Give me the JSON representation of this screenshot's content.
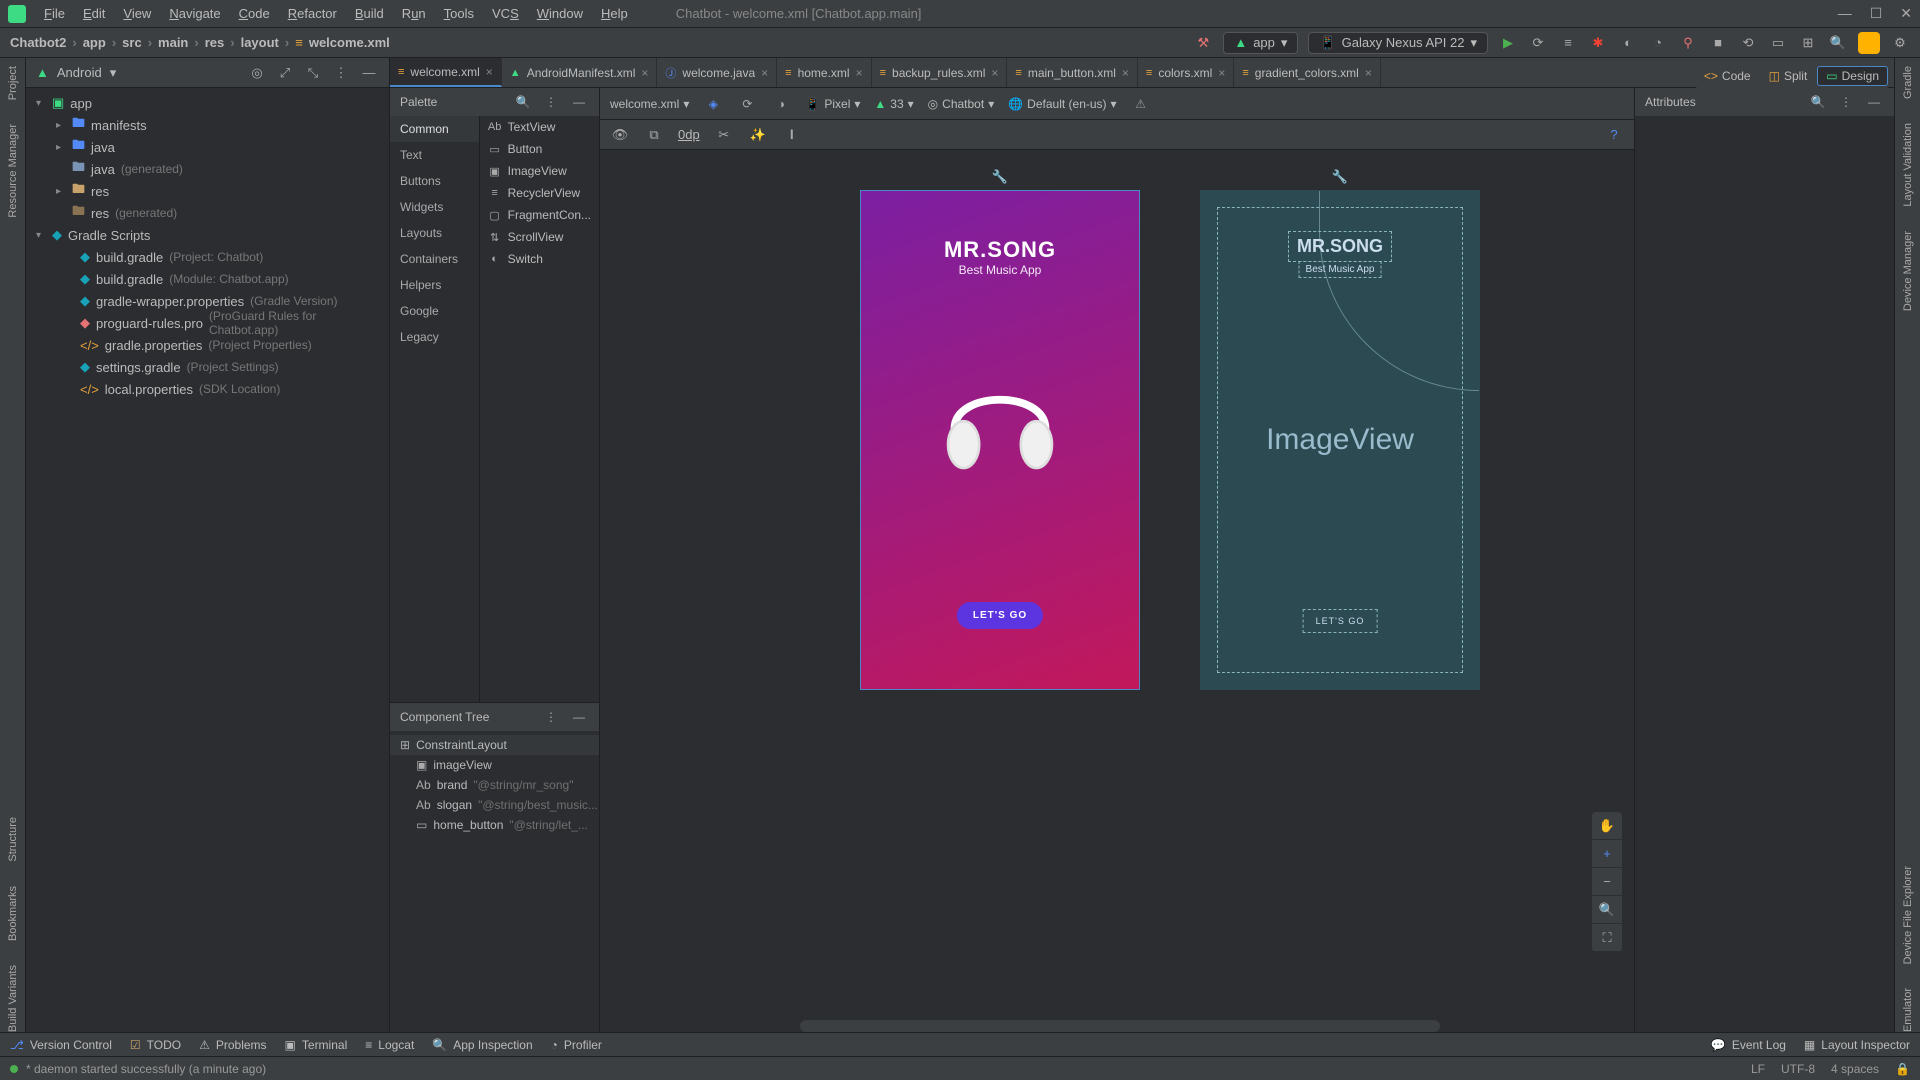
{
  "window": {
    "title": "Chatbot - welcome.xml [Chatbot.app.main]"
  },
  "menu": [
    "File",
    "Edit",
    "View",
    "Navigate",
    "Code",
    "Refactor",
    "Build",
    "Run",
    "Tools",
    "VCS",
    "Window",
    "Help"
  ],
  "breadcrumb": [
    "Chatbot2",
    "app",
    "src",
    "main",
    "res",
    "layout",
    "welcome.xml"
  ],
  "run_configs": {
    "app": "app",
    "device": "Galaxy Nexus API 22"
  },
  "project": {
    "selector": "Android",
    "root": "app",
    "children": [
      {
        "label": "manifests",
        "icon": "folder"
      },
      {
        "label": "java",
        "icon": "folder"
      },
      {
        "label": "java",
        "hint": "(generated)",
        "icon": "folder-gen"
      },
      {
        "label": "res",
        "icon": "folder"
      },
      {
        "label": "res",
        "hint": "(generated)",
        "icon": "folder-gen"
      }
    ],
    "gradle_root": "Gradle Scripts",
    "gradle": [
      {
        "label": "build.gradle",
        "hint": "(Project: Chatbot)"
      },
      {
        "label": "build.gradle",
        "hint": "(Module: Chatbot.app)"
      },
      {
        "label": "gradle-wrapper.properties",
        "hint": "(Gradle Version)"
      },
      {
        "label": "proguard-rules.pro",
        "hint": "(ProGuard Rules for Chatbot.app)"
      },
      {
        "label": "gradle.properties",
        "hint": "(Project Properties)"
      },
      {
        "label": "settings.gradle",
        "hint": "(Project Settings)"
      },
      {
        "label": "local.properties",
        "hint": "(SDK Location)"
      }
    ]
  },
  "tabs": [
    {
      "label": "welcome.xml",
      "kind": "xml",
      "active": true
    },
    {
      "label": "AndroidManifest.xml",
      "kind": "manifest"
    },
    {
      "label": "welcome.java",
      "kind": "java"
    },
    {
      "label": "home.xml",
      "kind": "xml"
    },
    {
      "label": "backup_rules.xml",
      "kind": "xml"
    },
    {
      "label": "main_button.xml",
      "kind": "xml"
    },
    {
      "label": "colors.xml",
      "kind": "xml"
    },
    {
      "label": "gradient_colors.xml",
      "kind": "xml"
    }
  ],
  "viewmode": {
    "code": "Code",
    "split": "Split",
    "design": "Design"
  },
  "palette": {
    "title": "Palette",
    "cats": [
      "Common",
      "Text",
      "Buttons",
      "Widgets",
      "Layouts",
      "Containers",
      "Helpers",
      "Google",
      "Legacy"
    ],
    "items": [
      "TextView",
      "Button",
      "ImageView",
      "RecyclerView",
      "FragmentCon...",
      "ScrollView",
      "Switch"
    ]
  },
  "canvas_toolbar": {
    "file": "welcome.xml",
    "device": "Pixel",
    "api": "33",
    "theme": "Chatbot",
    "locale": "Default (en-us)",
    "margin": "0dp"
  },
  "component_tree": {
    "title": "Component Tree",
    "root": "ConstraintLayout",
    "children": [
      {
        "label": "imageView",
        "icon": "image",
        "hint": ""
      },
      {
        "label": "brand",
        "icon": "text",
        "hint": "\"@string/mr_song\""
      },
      {
        "label": "slogan",
        "icon": "text",
        "hint": "\"@string/best_music..."
      },
      {
        "label": "home_button",
        "icon": "button",
        "hint": "\"@string/let_..."
      }
    ]
  },
  "preview": {
    "brand": "MR.SONG",
    "slogan": "Best Music App",
    "button": "LET'S GO",
    "blueprint_image_label": "ImageView"
  },
  "attributes": {
    "title": "Attributes"
  },
  "left_rail": [
    "Project",
    "Resource Manager",
    "Structure",
    "Bookmarks",
    "Build Variants"
  ],
  "right_rail": [
    "Gradle",
    "Layout Validation",
    "Device Manager",
    "Device File Explorer",
    "Emulator"
  ],
  "toolrow": [
    "Version Control",
    "TODO",
    "Problems",
    "Terminal",
    "Logcat",
    "App Inspection",
    "Profiler"
  ],
  "toolrow_right": [
    "Event Log",
    "Layout Inspector"
  ],
  "status": {
    "msg": "* daemon started successfully (a minute ago)",
    "lf": "LF",
    "enc": "UTF-8",
    "indent": "4 spaces"
  }
}
